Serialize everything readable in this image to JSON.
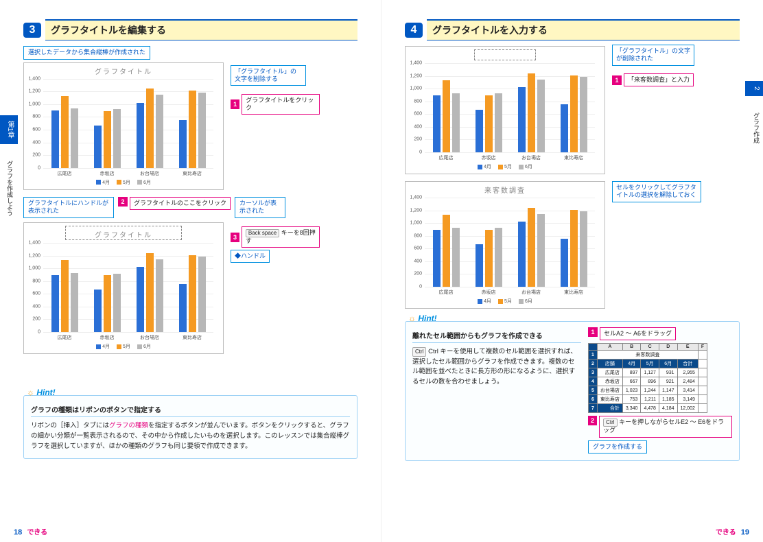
{
  "left": {
    "sideTabChapter": "第1章",
    "sideTabTitle": "グラフを作成しよう",
    "step": {
      "num": "3",
      "title": "グラフタイトルを編集する"
    },
    "caption_top": "選択したデータから集合縦棒が作成された",
    "annotations": {
      "a1": {
        "num": "1",
        "text": "グラフタイトルをクリック"
      },
      "a1_note": "「グラフタイトル」の文字を削除する",
      "row2a": "グラフタイトルにハンドルが表示された",
      "row2b": {
        "num": "2",
        "text": "グラフタイトルのここをクリック"
      },
      "row2c": "カーソルが表示された",
      "a3": {
        "num": "3",
        "text": "Backspace キーを8回押す"
      },
      "handle": "◆ハンドル"
    },
    "hint": {
      "tag": "Hint!",
      "title": "グラフの種類はリボンのボタンで指定する",
      "body_a": "リボンの［挿入］タブには",
      "body_em": "グラフの種類",
      "body_b": "を指定するボタンが並んでいます。ボタンをクリックすると、グラフの細かい分類が一覧表示されるので、その中から作成したいものを選択します。このレッスンでは集合縦棒グラフを選択していますが、ほかの種類のグラフも同じ要領で作成できます。"
    },
    "pagenum": "18",
    "brand": "できる"
  },
  "right": {
    "sideTabChapter": "2",
    "sideTabTitle": "グラフ作成",
    "step": {
      "num": "4",
      "title": "グラフタイトルを入力する"
    },
    "annotations": {
      "top_note": "「グラフタイトル」の文字が削除された",
      "a1": {
        "num": "1",
        "text": "「来客数調査」と入力"
      },
      "bottom_note": "セルをクリックしてグラフタイトルの選択を解除しておく"
    },
    "chart2_title": "来客数調査",
    "hint": {
      "tag": "Hint!",
      "title": "離れたセル範囲からもグラフを作成できる",
      "body": "Ctrl キーを使用して複数のセル範囲を選択すれば、選択したセル範囲からグラフを作成できます。複数のセル範囲を並べたときに長方形の形になるように、選択するセルの数を合わせましょう。",
      "a1": {
        "num": "1",
        "text": "セルA2 〜 A6をドラッグ"
      },
      "a2": {
        "num": "2",
        "text": "Ctrl キーを押しながらセルE2 〜 E6をドラッグ"
      },
      "a3": "グラフを作成する"
    },
    "table": {
      "title": "来客数調査",
      "cols": [
        "A",
        "B",
        "C",
        "D",
        "E",
        "F"
      ],
      "head": [
        "店舗",
        "4月",
        "5月",
        "6月",
        "合計"
      ],
      "rows": [
        [
          "広尾店",
          "897",
          "1,127",
          "931",
          "2,955"
        ],
        [
          "赤坂店",
          "667",
          "896",
          "921",
          "2,484"
        ],
        [
          "お台場店",
          "1,023",
          "1,244",
          "1,147",
          "3,414"
        ],
        [
          "東比寿店",
          "753",
          "1,211",
          "1,185",
          "3,149"
        ],
        [
          "合計",
          "3,340",
          "4,478",
          "4,184",
          "12,002"
        ]
      ]
    },
    "pagenum": "19",
    "brand": "できる"
  },
  "chart_data": {
    "type": "bar",
    "title_placeholder": "グラフタイトル",
    "categories": [
      "広尾店",
      "赤坂店",
      "お台場店",
      "東比寿店"
    ],
    "series": [
      {
        "name": "4月",
        "color": "#2a6fd6",
        "values": [
          897,
          667,
          1023,
          753
        ]
      },
      {
        "name": "5月",
        "color": "#f59a22",
        "values": [
          1127,
          896,
          1244,
          1211
        ]
      },
      {
        "name": "6月",
        "color": "#b7b7b7",
        "values": [
          931,
          921,
          1147,
          1185
        ]
      }
    ],
    "ylim": [
      0,
      1400
    ],
    "yticks": [
      0,
      200,
      400,
      600,
      800,
      1000,
      1200,
      1400
    ],
    "legend": [
      "4月",
      "5月",
      "6月"
    ]
  }
}
